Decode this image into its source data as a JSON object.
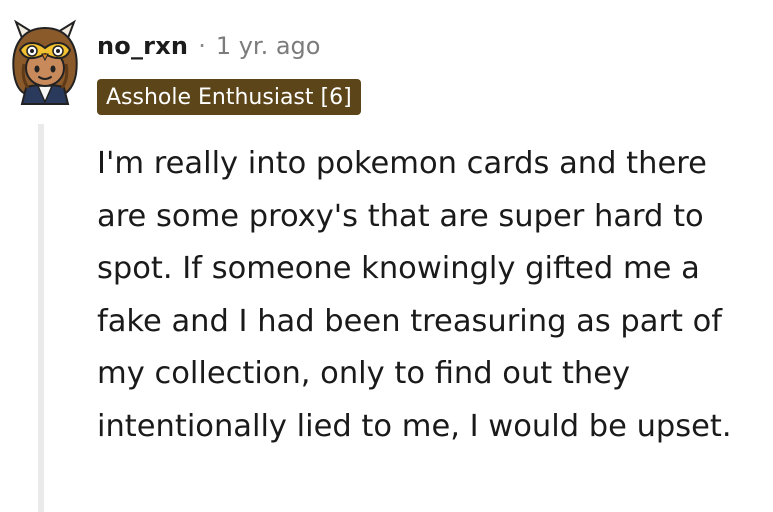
{
  "comment": {
    "username": "no_rxn",
    "separator": "·",
    "timestamp": "1 yr. ago",
    "flair": "Asshole Enthusiast [6]",
    "body": "I'm really into pokemon cards and there are some proxy's that are super hard to spot. If someone knowingly gifted me a fake and I had been treasuring as part of my collection, only to find out they intentionally lied to me, I would be upset."
  },
  "avatar": {
    "icon": "snoo-owl-costume-avatar",
    "colors": {
      "hood": "#8b5a2b",
      "mask": "#f2c230",
      "skin": "#c98a5b",
      "outline": "#222222"
    }
  },
  "colors": {
    "flair_background": "#5b4519",
    "flair_text": "#ffffff",
    "thread_line": "#eaeaea",
    "timestamp": "#7c7c7c"
  }
}
